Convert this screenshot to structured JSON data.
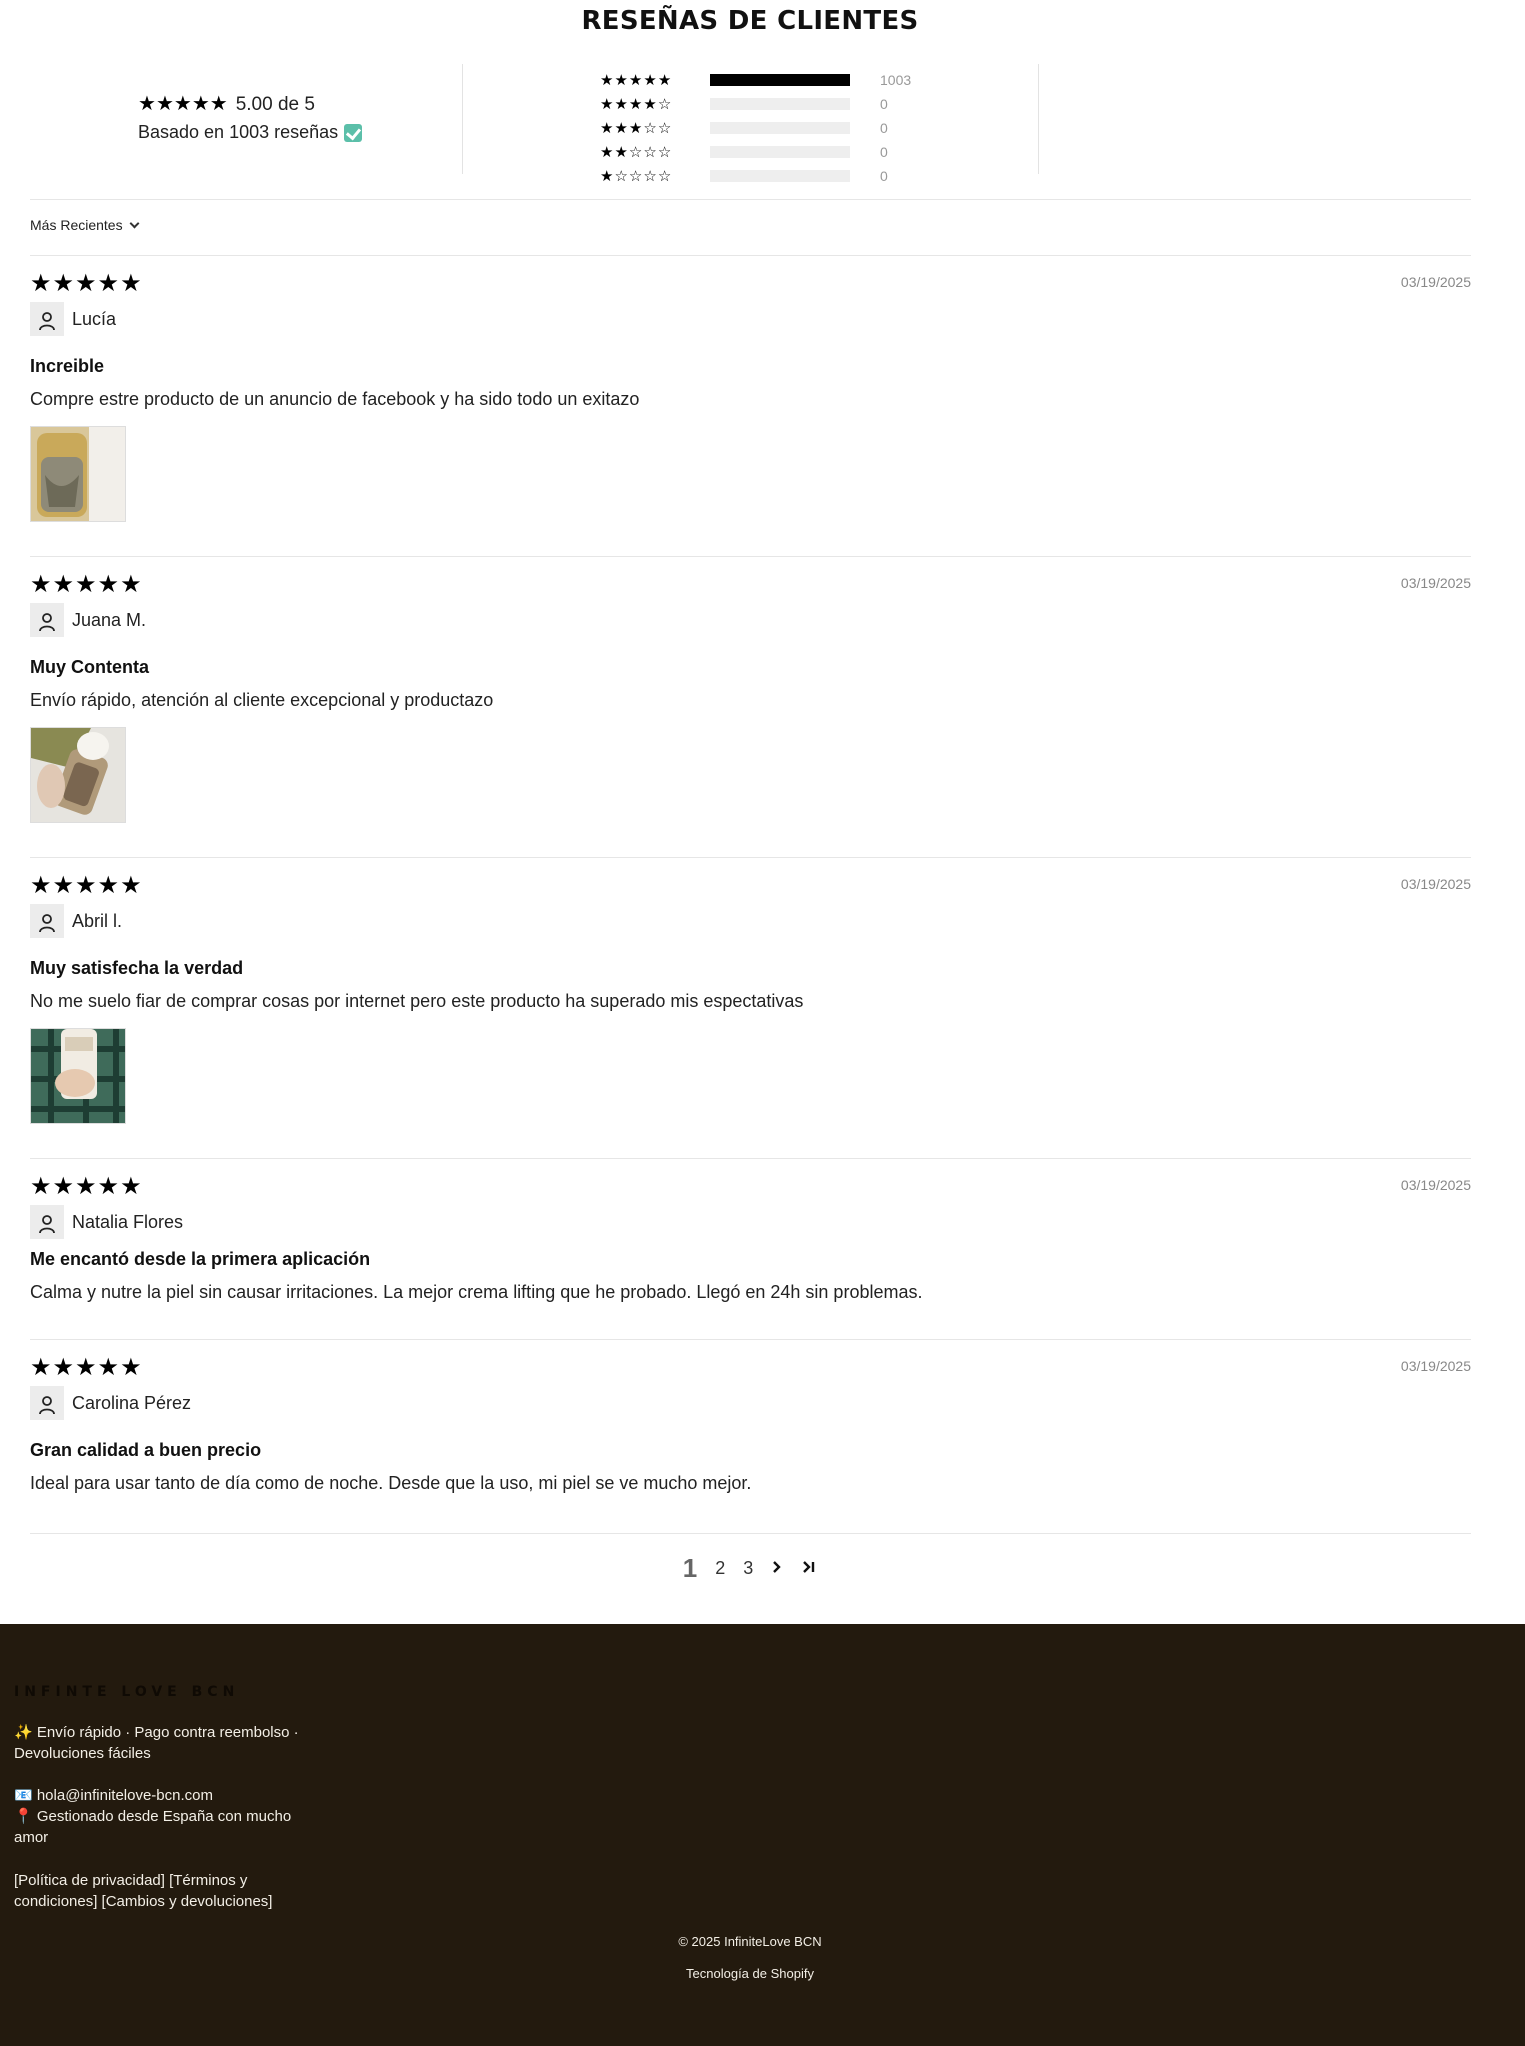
{
  "header": {
    "title": "RESEÑAS DE CLIENTES"
  },
  "summary": {
    "average": 5.0,
    "average_text": "5.00 de 5",
    "based_text": "Basado en 1003 reseñas",
    "histogram": [
      {
        "stars": 5,
        "count": 1003,
        "count_text": "1003",
        "fraction": 1.0
      },
      {
        "stars": 4,
        "count": 0,
        "count_text": "0",
        "fraction": 0
      },
      {
        "stars": 3,
        "count": 0,
        "count_text": "0",
        "fraction": 0
      },
      {
        "stars": 2,
        "count": 0,
        "count_text": "0",
        "fraction": 0
      },
      {
        "stars": 1,
        "count": 0,
        "count_text": "0",
        "fraction": 0
      }
    ]
  },
  "sort": {
    "label": "Más Recientes"
  },
  "reviews": [
    {
      "rating": 5,
      "date": "03/19/2025",
      "author": "Lucía",
      "title": "Increible",
      "body": "Compre estre producto de un anuncio de facebook y ha sido todo un exitazo",
      "has_photo": true
    },
    {
      "rating": 5,
      "date": "03/19/2025",
      "author": "Juana M.",
      "title": "Muy Contenta",
      "body": "Envío rápido, atención al cliente excepcional y productazo",
      "has_photo": true
    },
    {
      "rating": 5,
      "date": "03/19/2025",
      "author": "Abril l.",
      "title": "Muy satisfecha la verdad",
      "body": "No me suelo fiar de comprar cosas por internet pero este producto ha superado mis espectativas",
      "has_photo": true
    },
    {
      "rating": 5,
      "date": "03/19/2025",
      "author": "Natalia Flores",
      "title": "Me encantó desde la primera aplicación",
      "body": "Calma y nutre la piel sin causar irritaciones. La mejor crema lifting que he probado. Llegó en 24h sin problemas.",
      "has_photo": false
    },
    {
      "rating": 5,
      "date": "03/19/2025",
      "author": "Carolina Pérez",
      "title": "Gran calidad a buen precio",
      "body": "Ideal para usar tanto de día como de noche. Desde que la uso, mi piel se ve mucho mejor.",
      "has_photo": false
    }
  ],
  "pagination": {
    "pages": [
      "1",
      "2",
      "3"
    ],
    "current": "1",
    "next_icon": "chevron-right-icon",
    "last_icon": "chevron-last-icon"
  },
  "footer": {
    "brand": "INFINTE LOVE BCN",
    "shipping": "✨ Envío rápido · Pago contra reembolso · Devoluciones fáciles",
    "email": "📧 hola@infinitelove-bcn.com",
    "location": "📍 Gestionado desde España con mucho amor",
    "links": "[Política de privacidad] [Términos y condiciones] [Cambios y devoluciones]",
    "copyright": "© 2025 InfiniteLove BCN",
    "powered": "Tecnología de Shopify"
  },
  "colors": {
    "footer_bg": "#231a0e",
    "verified": "#5bbfa9",
    "star": "#000000"
  }
}
